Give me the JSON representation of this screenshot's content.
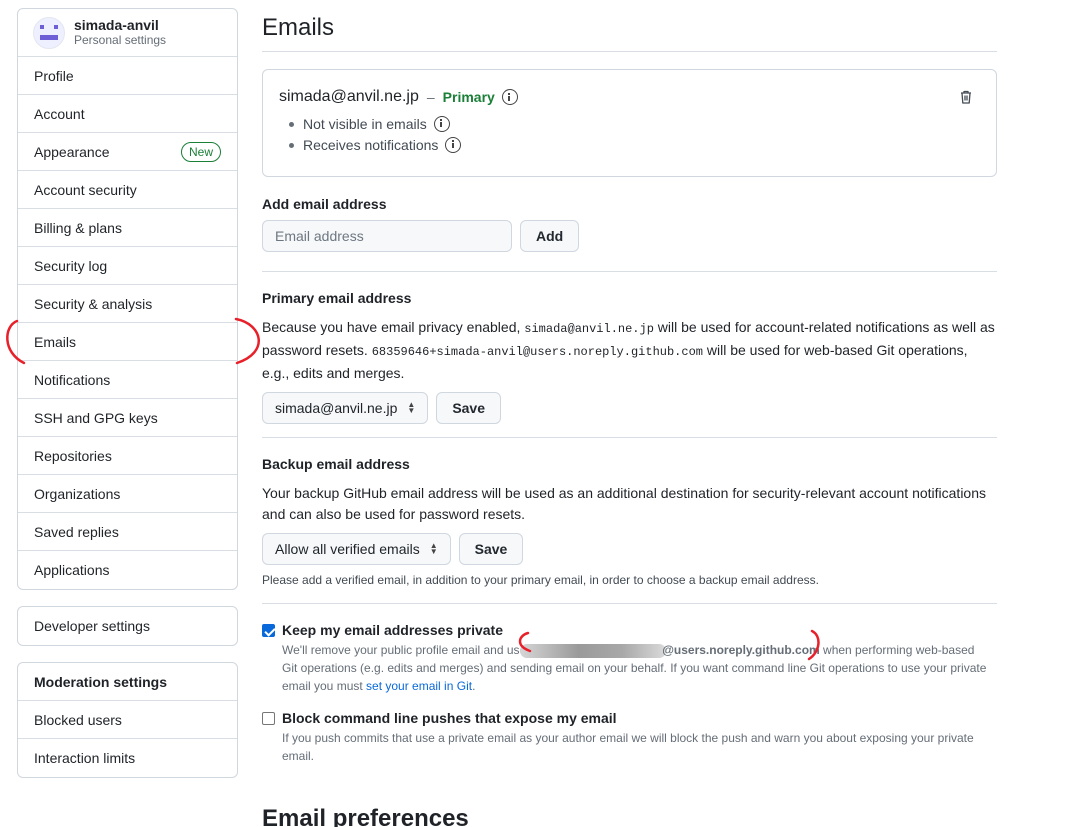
{
  "sidebar": {
    "profile": {
      "username": "simada-anvil",
      "subtitle": "Personal settings"
    },
    "items": [
      {
        "label": "Profile"
      },
      {
        "label": "Account"
      },
      {
        "label": "Appearance",
        "badge": "New"
      },
      {
        "label": "Account security"
      },
      {
        "label": "Billing & plans"
      },
      {
        "label": "Security log"
      },
      {
        "label": "Security & analysis"
      },
      {
        "label": "Emails"
      },
      {
        "label": "Notifications"
      },
      {
        "label": "SSH and GPG keys"
      },
      {
        "label": "Repositories"
      },
      {
        "label": "Organizations"
      },
      {
        "label": "Saved replies"
      },
      {
        "label": "Applications"
      }
    ],
    "developer": {
      "label": "Developer settings"
    },
    "moderation": {
      "heading": "Moderation settings",
      "items": [
        {
          "label": "Blocked users"
        },
        {
          "label": "Interaction limits"
        }
      ]
    }
  },
  "main": {
    "title": "Emails",
    "email_card": {
      "address": "simada@anvil.ne.jp",
      "separator": "–",
      "status": "Primary",
      "bullets": [
        "Not visible in emails",
        "Receives notifications"
      ]
    },
    "add_email": {
      "label": "Add email address",
      "placeholder": "Email address",
      "button": "Add"
    },
    "primary": {
      "label": "Primary email address",
      "text_1": "Because you have email privacy enabled, ",
      "code_1": "simada@anvil.ne.jp",
      "text_2": " will be used for account-related notifications as well as password resets. ",
      "code_2": "68359646+simada-anvil@users.noreply.github.com",
      "text_3": " will be used for web-based Git operations, e.g., edits and merges.",
      "select_value": "simada@anvil.ne.jp",
      "button": "Save"
    },
    "backup": {
      "label": "Backup email address",
      "text": "Your backup GitHub email address will be used as an additional destination for security-relevant account notifications and can also be used for password resets.",
      "select_value": "Allow all verified emails",
      "button": "Save",
      "note": "Please add a verified email, in addition to your primary email, in order to choose a backup email address."
    },
    "keep_private": {
      "checked": true,
      "title": "Keep my email addresses private",
      "desc_1": "We'll remove your public profile email and use",
      "noreply": "@users.noreply.github.com",
      "desc_2": " when performing web-based Git operations (e.g. edits and merges) and sending email on your behalf. If you want command line Git operations to use your private email you must ",
      "link": "set your email in Git",
      "desc_3": "."
    },
    "block_pushes": {
      "checked": false,
      "title": "Block command line pushes that expose my email",
      "desc": "If you push commits that use a private email as your author email we will block the push and warn you about exposing your private email."
    },
    "prefs_title": "Email preferences"
  },
  "colors": {
    "primary_green": "#1a7f37",
    "link_blue": "#0969da",
    "annotation_red": "#e8202a",
    "border": "#d0d7de"
  },
  "icons": {
    "info": "info-icon",
    "trash": "trash-icon",
    "select_arrows": "select-arrows-icon",
    "checkbox": "checkbox-icon"
  }
}
